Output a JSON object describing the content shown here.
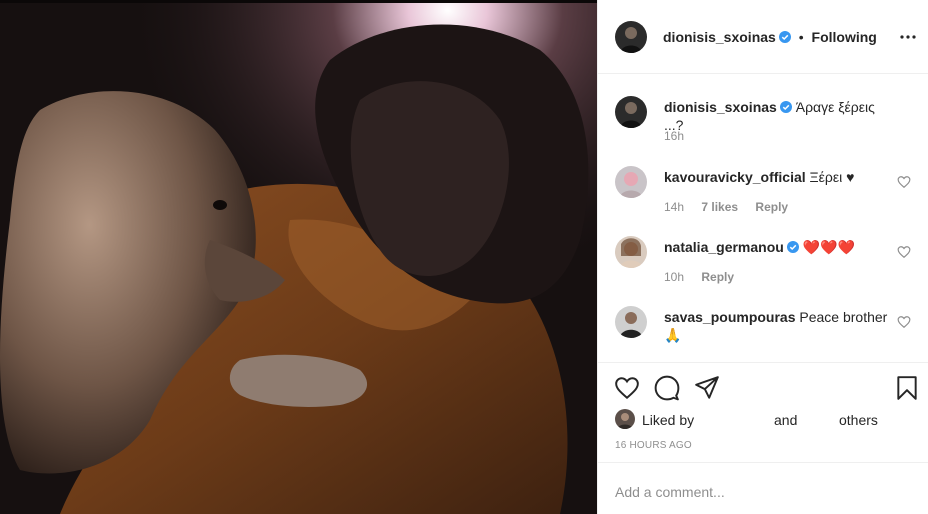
{
  "post": {
    "author": {
      "username": "dionisis_sxoinas",
      "verified": true
    },
    "follow_separator": "•",
    "follow_state": "Following",
    "caption": {
      "username": "dionisis_sxoinas",
      "text": "Άραγε ξέρεις ...?",
      "age": "16h"
    }
  },
  "comments": [
    {
      "username": "kavouravicky_official",
      "verified": false,
      "text": "Ξέρει ♥",
      "age": "14h",
      "likes": "7 likes",
      "reply": "Reply"
    },
    {
      "username": "natalia_germanou",
      "verified": true,
      "text": "❤️❤️❤️",
      "age": "10h",
      "likes": "",
      "reply": "Reply"
    },
    {
      "username": "savas_poumpouras",
      "verified": false,
      "text": "Peace brother 🙏",
      "age": "",
      "likes": "",
      "reply": ""
    }
  ],
  "actions": {
    "like_icon": "heart-icon",
    "comment_icon": "comment-icon",
    "share_icon": "paper-plane-icon",
    "save_icon": "bookmark-icon"
  },
  "likes_summary": {
    "prefix": "Liked by",
    "middle": "and",
    "suffix": "others"
  },
  "timestamp": "16 HOURS AGO",
  "add_comment_placeholder": "Add a comment...",
  "colors": {
    "accent_blue": "#3897f0",
    "muted": "#8e8e8e",
    "heart_red": "#ed4956"
  }
}
